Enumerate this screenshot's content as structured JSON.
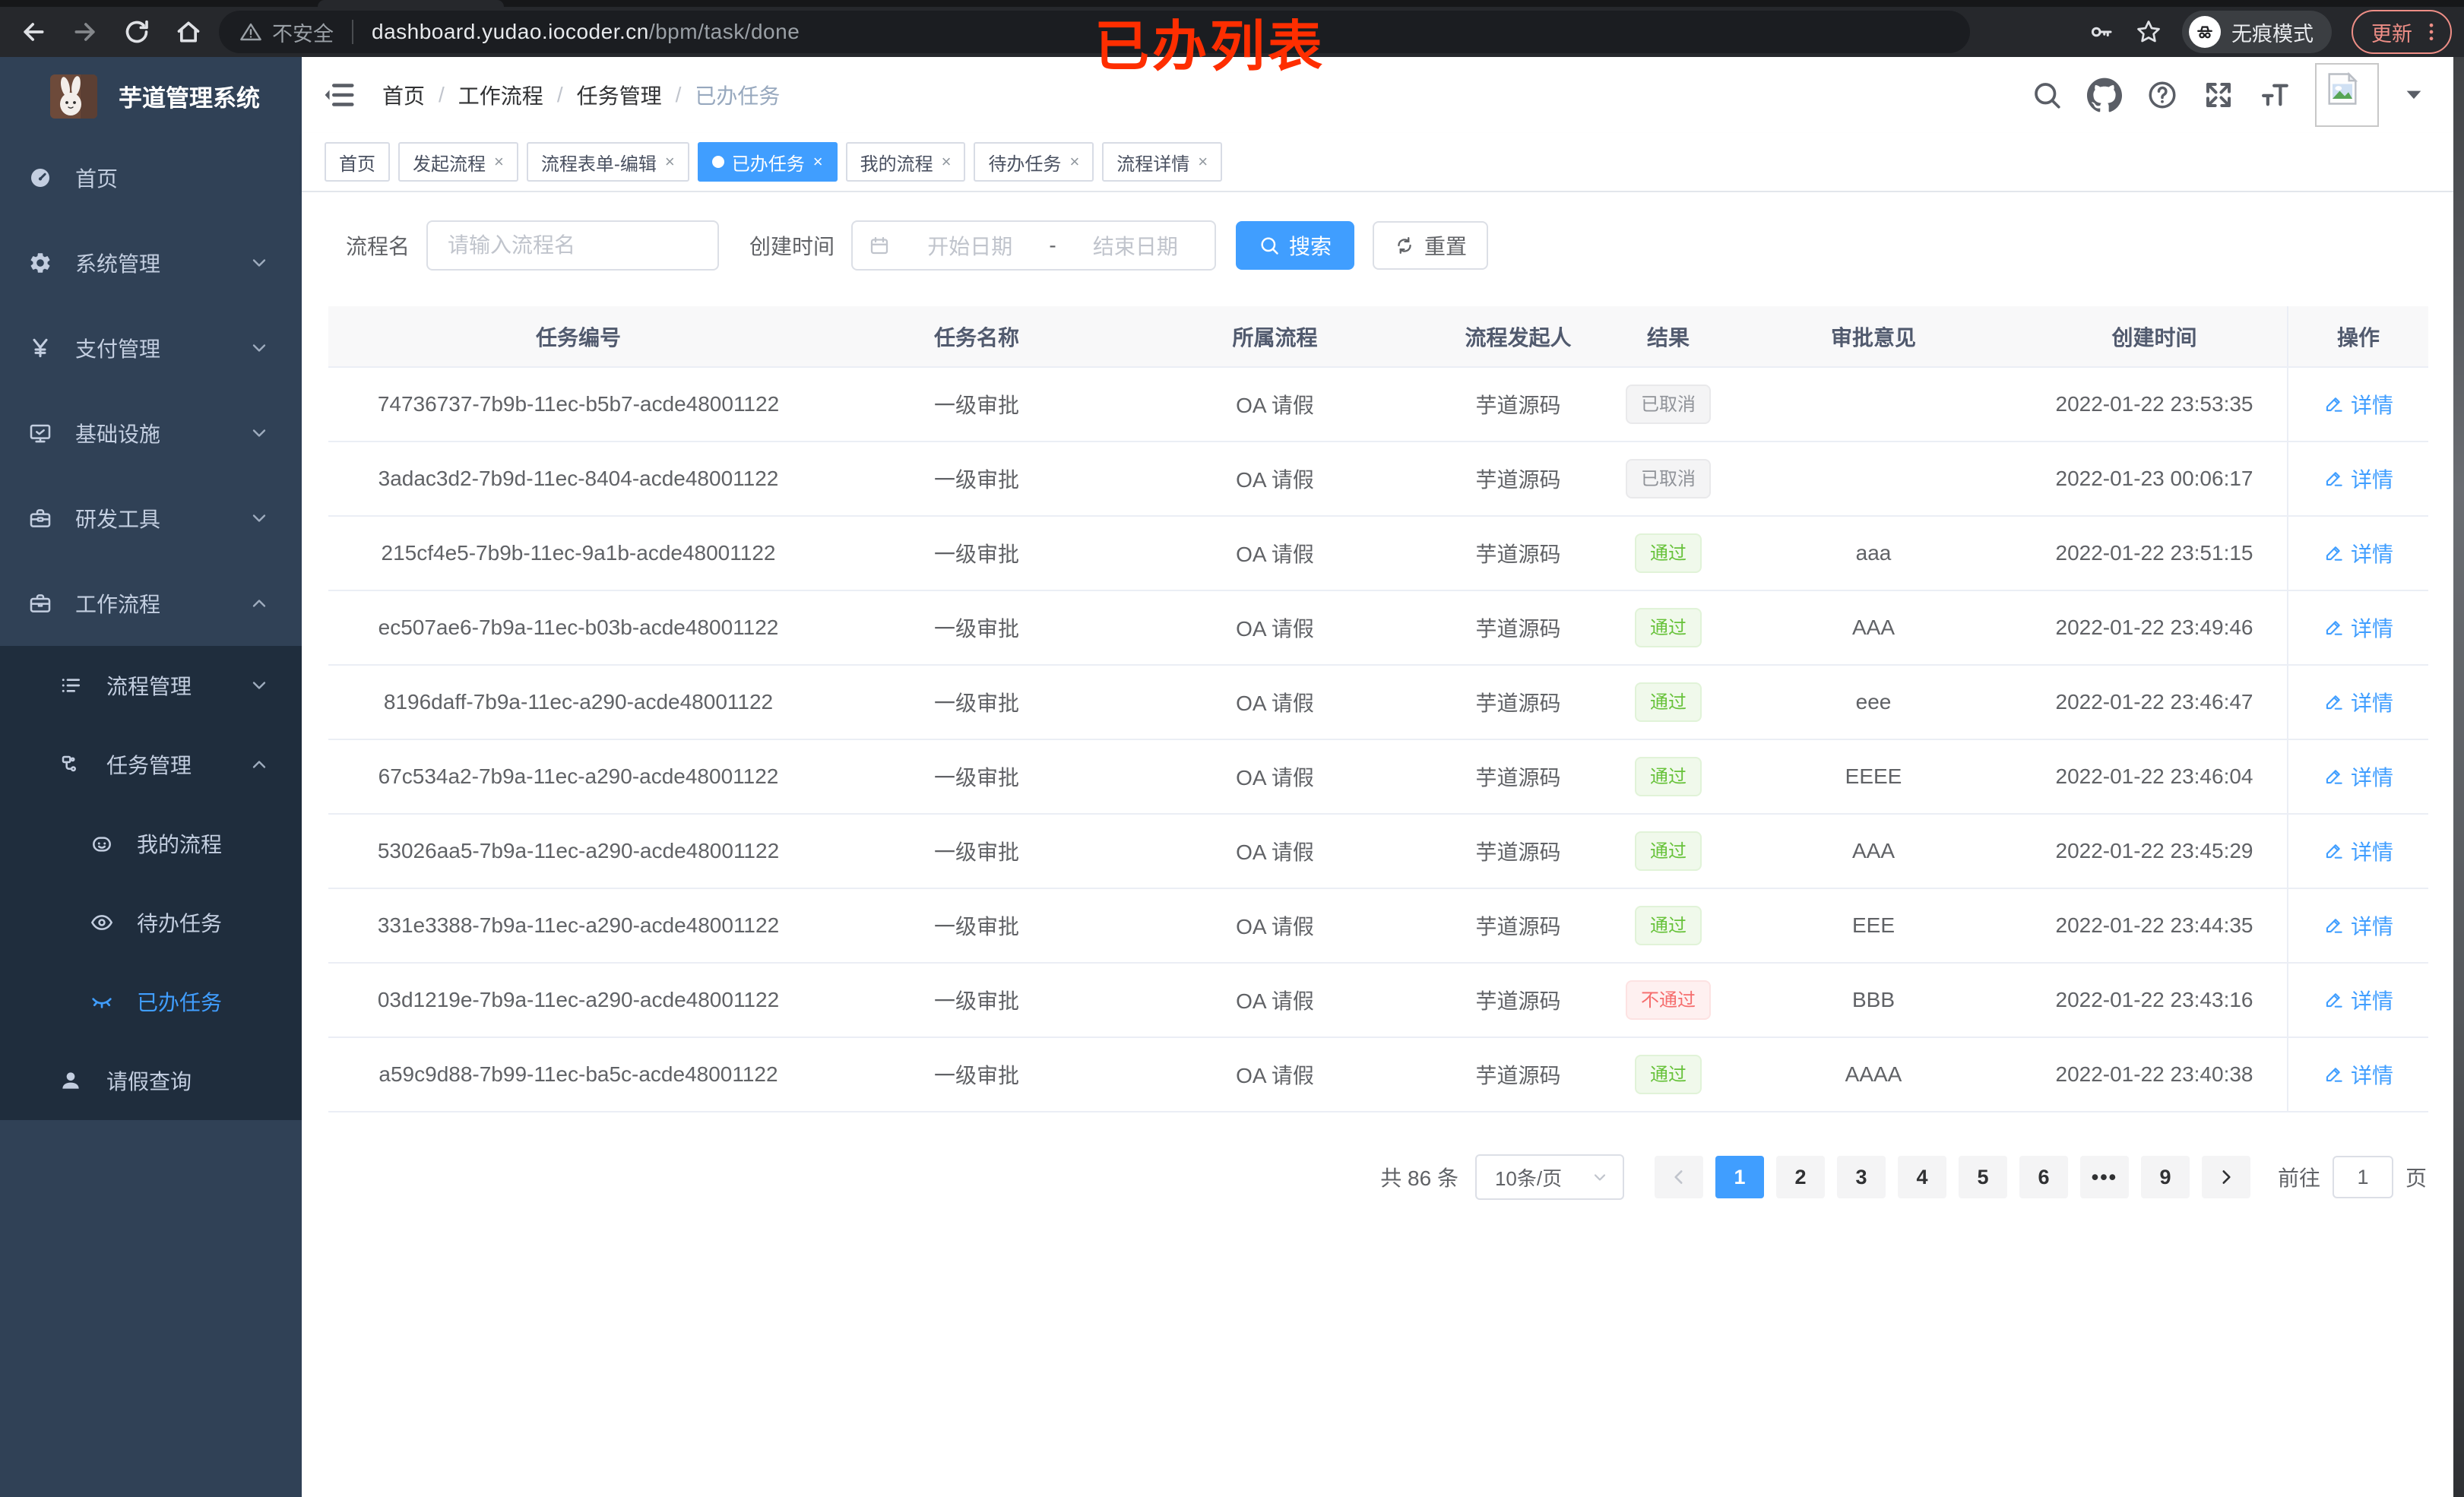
{
  "browser": {
    "security_label": "不安全",
    "url_domain": "dashboard.yudao.iocoder.cn",
    "url_path": "/bpm/task/done",
    "incognito_label": "无痕模式",
    "update_label": "更新"
  },
  "annotation": {
    "text": "已办列表",
    "color": "#fe2e00"
  },
  "sidebar": {
    "title": "芋道管理系统",
    "menu": [
      {
        "id": "home",
        "label": "首页",
        "icon": "dashboard-icon",
        "level": 1,
        "chevron": "",
        "sub": false,
        "active": false
      },
      {
        "id": "system",
        "label": "系统管理",
        "icon": "gear-icon",
        "level": 1,
        "chevron": "down",
        "sub": false,
        "active": false
      },
      {
        "id": "payment",
        "label": "支付管理",
        "icon": "yen-icon",
        "level": 1,
        "chevron": "down",
        "sub": false,
        "active": false
      },
      {
        "id": "infra",
        "label": "基础设施",
        "icon": "monitor-icon",
        "level": 1,
        "chevron": "down",
        "sub": false,
        "active": false
      },
      {
        "id": "devtools",
        "label": "研发工具",
        "icon": "toolbox-icon",
        "level": 1,
        "chevron": "down",
        "sub": false,
        "active": false
      },
      {
        "id": "workflow",
        "label": "工作流程",
        "icon": "briefcase-icon",
        "level": 1,
        "chevron": "up",
        "sub": false,
        "active": false
      },
      {
        "id": "process-mgmt",
        "label": "流程管理",
        "icon": "flow-list-icon",
        "level": 2,
        "chevron": "down",
        "sub": true,
        "active": false
      },
      {
        "id": "task-mgmt",
        "label": "任务管理",
        "icon": "org-icon",
        "level": 2,
        "chevron": "up",
        "sub": true,
        "active": false
      },
      {
        "id": "my-process",
        "label": "我的流程",
        "icon": "robot-icon",
        "level": 3,
        "chevron": "",
        "sub": true,
        "active": false
      },
      {
        "id": "todo-task",
        "label": "待办任务",
        "icon": "eye-icon",
        "level": 3,
        "chevron": "",
        "sub": true,
        "active": false
      },
      {
        "id": "done-task",
        "label": "已办任务",
        "icon": "eye-closed-icon",
        "level": 3,
        "chevron": "",
        "sub": true,
        "active": true
      },
      {
        "id": "leave-query",
        "label": "请假查询",
        "icon": "user-icon",
        "level": 2,
        "chevron": "",
        "sub": true,
        "active": false
      }
    ]
  },
  "navbar": {
    "breadcrumb": [
      "首页",
      "工作流程",
      "任务管理",
      "已办任务"
    ]
  },
  "tabs": [
    {
      "label": "首页",
      "closable": false,
      "active": false
    },
    {
      "label": "发起流程",
      "closable": true,
      "active": false
    },
    {
      "label": "流程表单-编辑",
      "closable": true,
      "active": false
    },
    {
      "label": "已办任务",
      "closable": true,
      "active": true
    },
    {
      "label": "我的流程",
      "closable": true,
      "active": false
    },
    {
      "label": "待办任务",
      "closable": true,
      "active": false
    },
    {
      "label": "流程详情",
      "closable": true,
      "active": false
    }
  ],
  "filters": {
    "name_label": "流程名",
    "name_placeholder": "请输入流程名",
    "time_label": "创建时间",
    "start_placeholder": "开始日期",
    "range_separator": "-",
    "end_placeholder": "结束日期",
    "search_label": "搜索",
    "reset_label": "重置"
  },
  "table": {
    "columns": [
      "任务编号",
      "任务名称",
      "所属流程",
      "流程发起人",
      "结果",
      "审批意见",
      "创建时间",
      "操作"
    ],
    "detail_label": "详情",
    "rows": [
      {
        "id": "74736737-7b9b-11ec-b5b7-acde48001122",
        "name": "一级审批",
        "process": "OA 请假",
        "starter": "芋道源码",
        "result": {
          "text": "已取消",
          "type": "info"
        },
        "opinion": "",
        "created": "2022-01-22 23:53:35"
      },
      {
        "id": "3adac3d2-7b9d-11ec-8404-acde48001122",
        "name": "一级审批",
        "process": "OA 请假",
        "starter": "芋道源码",
        "result": {
          "text": "已取消",
          "type": "info"
        },
        "opinion": "",
        "created": "2022-01-23 00:06:17"
      },
      {
        "id": "215cf4e5-7b9b-11ec-9a1b-acde48001122",
        "name": "一级审批",
        "process": "OA 请假",
        "starter": "芋道源码",
        "result": {
          "text": "通过",
          "type": "success"
        },
        "opinion": "aaa",
        "created": "2022-01-22 23:51:15"
      },
      {
        "id": "ec507ae6-7b9a-11ec-b03b-acde48001122",
        "name": "一级审批",
        "process": "OA 请假",
        "starter": "芋道源码",
        "result": {
          "text": "通过",
          "type": "success"
        },
        "opinion": "AAA",
        "created": "2022-01-22 23:49:46"
      },
      {
        "id": "8196daff-7b9a-11ec-a290-acde48001122",
        "name": "一级审批",
        "process": "OA 请假",
        "starter": "芋道源码",
        "result": {
          "text": "通过",
          "type": "success"
        },
        "opinion": "eee",
        "created": "2022-01-22 23:46:47"
      },
      {
        "id": "67c534a2-7b9a-11ec-a290-acde48001122",
        "name": "一级审批",
        "process": "OA 请假",
        "starter": "芋道源码",
        "result": {
          "text": "通过",
          "type": "success"
        },
        "opinion": "EEEE",
        "created": "2022-01-22 23:46:04"
      },
      {
        "id": "53026aa5-7b9a-11ec-a290-acde48001122",
        "name": "一级审批",
        "process": "OA 请假",
        "starter": "芋道源码",
        "result": {
          "text": "通过",
          "type": "success"
        },
        "opinion": "AAA",
        "created": "2022-01-22 23:45:29"
      },
      {
        "id": "331e3388-7b9a-11ec-a290-acde48001122",
        "name": "一级审批",
        "process": "OA 请假",
        "starter": "芋道源码",
        "result": {
          "text": "通过",
          "type": "success"
        },
        "opinion": "EEE",
        "created": "2022-01-22 23:44:35"
      },
      {
        "id": "03d1219e-7b9a-11ec-a290-acde48001122",
        "name": "一级审批",
        "process": "OA 请假",
        "starter": "芋道源码",
        "result": {
          "text": "不通过",
          "type": "danger"
        },
        "opinion": "BBB",
        "created": "2022-01-22 23:43:16"
      },
      {
        "id": "a59c9d88-7b99-11ec-ba5c-acde48001122",
        "name": "一级审批",
        "process": "OA 请假",
        "starter": "芋道源码",
        "result": {
          "text": "通过",
          "type": "success"
        },
        "opinion": "AAAA",
        "created": "2022-01-22 23:40:38"
      }
    ]
  },
  "pagination": {
    "total_label": "共 86 条",
    "page_size": "10条/页",
    "pages": [
      "1",
      "2",
      "3",
      "4",
      "5",
      "6",
      "•••",
      "9"
    ],
    "active_page": "1",
    "goto_label": "前往",
    "goto_value": "1",
    "page_unit": "页"
  },
  "colors": {
    "accent": "#409eff",
    "success": "#67c23a",
    "danger": "#f56c6c",
    "info": "#909399",
    "sidebar": "#304156",
    "submenu": "#1f2d3d"
  }
}
